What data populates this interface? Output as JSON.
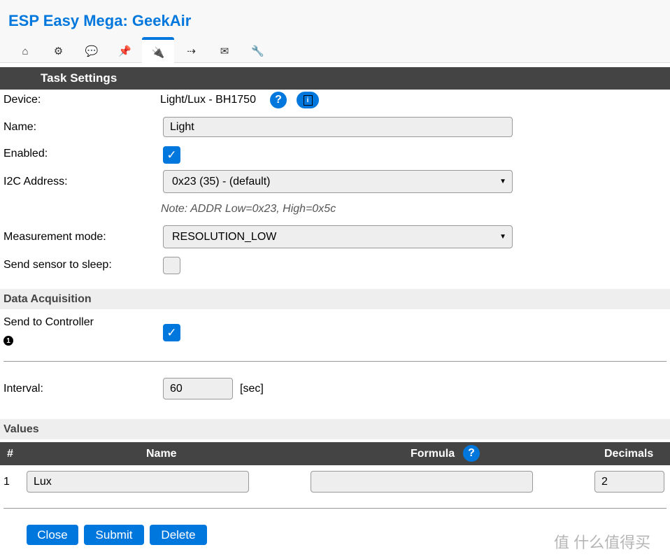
{
  "app": {
    "title": "ESP Easy Mega: GeekAir"
  },
  "tabs": [
    {
      "icon": "home-icon",
      "glyph": "⌂"
    },
    {
      "icon": "gear-icon",
      "glyph": "⚙"
    },
    {
      "icon": "chat-icon",
      "glyph": "💬"
    },
    {
      "icon": "pin-icon",
      "glyph": "📌"
    },
    {
      "icon": "plug-icon",
      "glyph": "🔌",
      "active": true
    },
    {
      "icon": "arrow-icon",
      "glyph": "⇢"
    },
    {
      "icon": "mail-icon",
      "glyph": "✉"
    },
    {
      "icon": "wrench-icon",
      "glyph": "🔧"
    }
  ],
  "task": {
    "header": "Task Settings",
    "device_label": "Device:",
    "device_value": "Light/Lux - BH1750",
    "help": "?",
    "info": "i",
    "name_label": "Name:",
    "name_value": "Light",
    "enabled_label": "Enabled:",
    "enabled": true,
    "i2c_label": "I2C Address:",
    "i2c_value": "0x23 (35) - (default)",
    "note": "Note: ADDR Low=0x23, High=0x5c",
    "mode_label": "Measurement mode:",
    "mode_value": "RESOLUTION_LOW",
    "sleep_label": "Send sensor to sleep:",
    "sleep": false
  },
  "acq": {
    "header": "Data Acquisition",
    "send_label": "Send to Controller",
    "controller_badge": "1",
    "send": true,
    "interval_label": "Interval:",
    "interval_value": "60",
    "interval_unit": "[sec]"
  },
  "values": {
    "header": "Values",
    "columns": [
      "#",
      "Name",
      "Formula",
      "Decimals"
    ],
    "rows": [
      {
        "num": "1",
        "name": "Lux",
        "formula": "",
        "decimals": "2"
      }
    ]
  },
  "buttons": {
    "close": "Close",
    "submit": "Submit",
    "delete": "Delete"
  },
  "watermark": "值 什么值得买",
  "colors": {
    "accent": "#0077dd",
    "header_bar": "#444444"
  }
}
